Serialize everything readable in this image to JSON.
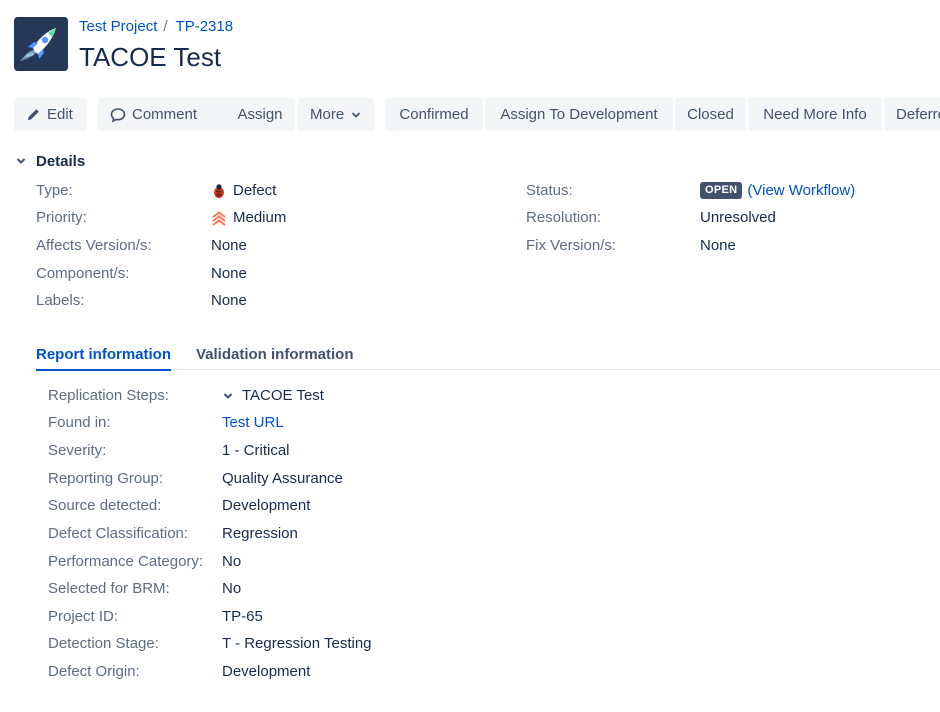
{
  "breadcrumb": {
    "project": "Test Project",
    "separator": "/",
    "issue_key": "TP-2318"
  },
  "issue": {
    "title": "TACOE Test"
  },
  "toolbar": {
    "edit": "Edit",
    "comment": "Comment",
    "assign": "Assign",
    "more": "More",
    "confirmed": "Confirmed",
    "assign_to_development": "Assign To Development",
    "closed": "Closed",
    "need_more_info": "Need More Info",
    "deferred": "Deferred"
  },
  "details": {
    "heading": "Details",
    "type_label": "Type:",
    "type_value": "Defect",
    "priority_label": "Priority:",
    "priority_value": "Medium",
    "affects_label": "Affects Version/s:",
    "affects_value": "None",
    "component_label": "Component/s:",
    "component_value": "None",
    "labels_label": "Labels:",
    "labels_value": "None",
    "status_label": "Status:",
    "status_lozenge": "OPEN",
    "view_workflow_open": "(",
    "view_workflow": "View Workflow",
    "view_workflow_close": ")",
    "resolution_label": "Resolution:",
    "resolution_value": "Unresolved",
    "fix_label": "Fix Version/s:",
    "fix_value": "None"
  },
  "tabs": {
    "report": "Report information",
    "validation": "Validation information"
  },
  "report_info": {
    "replication_label": "Replication Steps:",
    "replication_value": "TACOE Test",
    "found_label": "Found in:",
    "found_value": "Test URL",
    "severity_label": "Severity:",
    "severity_value": "1 - Critical",
    "reporting_group_label": "Reporting Group:",
    "reporting_group_value": "Quality Assurance",
    "source_label": "Source detected:",
    "source_value": "Development",
    "classification_label": "Defect Classification:",
    "classification_value": "Regression",
    "performance_label": "Performance Category:",
    "performance_value": "No",
    "brm_label": "Selected for BRM:",
    "brm_value": "No",
    "project_id_label": "Project ID:",
    "project_id_value": "TP-65",
    "detection_label": "Detection Stage:",
    "detection_value": "T - Regression Testing",
    "origin_label": "Defect Origin:",
    "origin_value": "Development"
  },
  "colors": {
    "link": "#0052cc",
    "button_bg": "#f4f5f7",
    "lozenge_bg": "#42526e",
    "priority_medium": "#ff7452",
    "defect_red": "#de350b"
  },
  "icons": {
    "avatar": "rocket-icon",
    "edit": "pencil-icon",
    "comment": "comment-bubble-icon",
    "more": "chevron-down-icon",
    "details_toggle": "chevron-down-icon",
    "type": "bug-icon",
    "priority": "priority-medium-icon",
    "replication_toggle": "chevron-down-icon"
  }
}
